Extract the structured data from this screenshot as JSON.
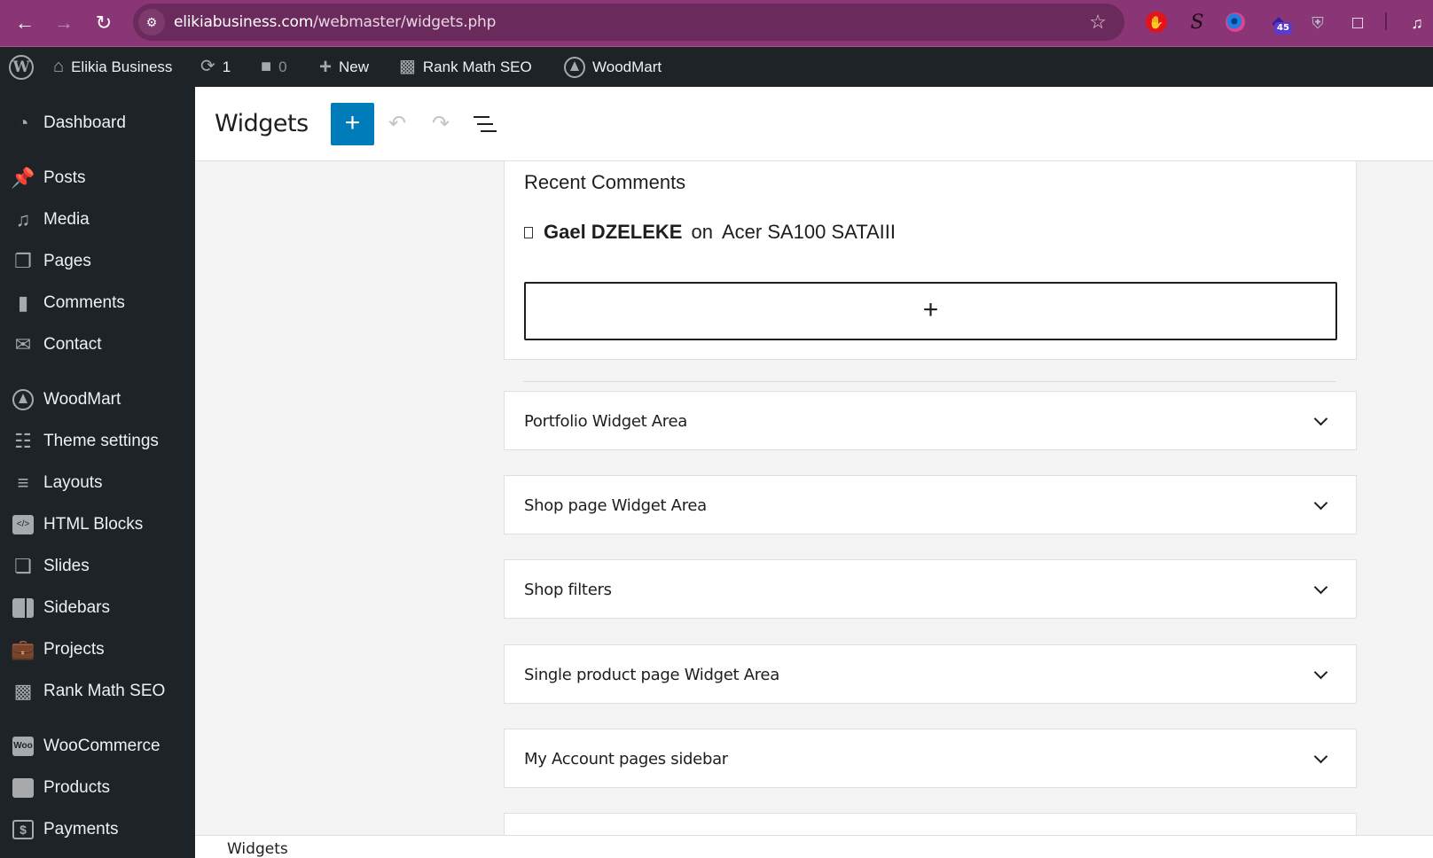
{
  "browser": {
    "url_host": "elikiabusiness.com",
    "url_path": "/webmaster/widgets.php",
    "extension_badge": "45",
    "icons": [
      "back-icon",
      "forward-icon",
      "reload-icon",
      "site-info-icon",
      "bookmark-star-icon",
      "adblock-icon",
      "s-extension-icon",
      "globe-extension-icon",
      "graduation-cap-icon",
      "shield-icon",
      "puzzle-icon",
      "media-control-icon"
    ]
  },
  "adminbar": {
    "site_name": "Elikia Business",
    "updates_count": "1",
    "comments_count": "0",
    "new_label": "New",
    "rankmath_label": "Rank Math SEO",
    "woodmart_label": "WoodMart"
  },
  "sidebar": {
    "items": [
      {
        "label": "Dashboard",
        "icon": "dashboard-icon"
      },
      {
        "label": "Posts",
        "icon": "pin-icon"
      },
      {
        "label": "Media",
        "icon": "media-icon"
      },
      {
        "label": "Pages",
        "icon": "pages-icon"
      },
      {
        "label": "Comments",
        "icon": "comment-icon"
      },
      {
        "label": "Contact",
        "icon": "envelope-icon"
      },
      {
        "label": "WoodMart",
        "icon": "woodmart-icon"
      },
      {
        "label": "Theme settings",
        "icon": "sliders-icon"
      },
      {
        "label": "Layouts",
        "icon": "layers-icon"
      },
      {
        "label": "HTML Blocks",
        "icon": "code-block-icon"
      },
      {
        "label": "Slides",
        "icon": "slides-icon"
      },
      {
        "label": "Sidebars",
        "icon": "sidebar-icon"
      },
      {
        "label": "Projects",
        "icon": "briefcase-icon"
      },
      {
        "label": "Rank Math SEO",
        "icon": "rankmath-icon"
      },
      {
        "label": "WooCommerce",
        "icon": "woo-icon"
      },
      {
        "label": "Products",
        "icon": "archive-box-icon"
      },
      {
        "label": "Payments",
        "icon": "dollar-icon"
      }
    ]
  },
  "header": {
    "title": "Widgets",
    "add_block_label": "+",
    "undo_label": "Undo",
    "redo_label": "Redo",
    "list_view_label": "List View"
  },
  "recent_comments": {
    "title": "Recent Comments",
    "author": "Gael DZELEKE",
    "connector": "on",
    "post": "Acer SA100 SATAIII",
    "appender_label": "+"
  },
  "widget_areas": [
    {
      "label": "Portfolio Widget Area"
    },
    {
      "label": "Shop page Widget Area"
    },
    {
      "label": "Shop filters"
    },
    {
      "label": "Single product page Widget Area"
    },
    {
      "label": "My Account pages sidebar"
    },
    {
      "label": ""
    }
  ],
  "footer": {
    "breadcrumb": "Widgets"
  }
}
